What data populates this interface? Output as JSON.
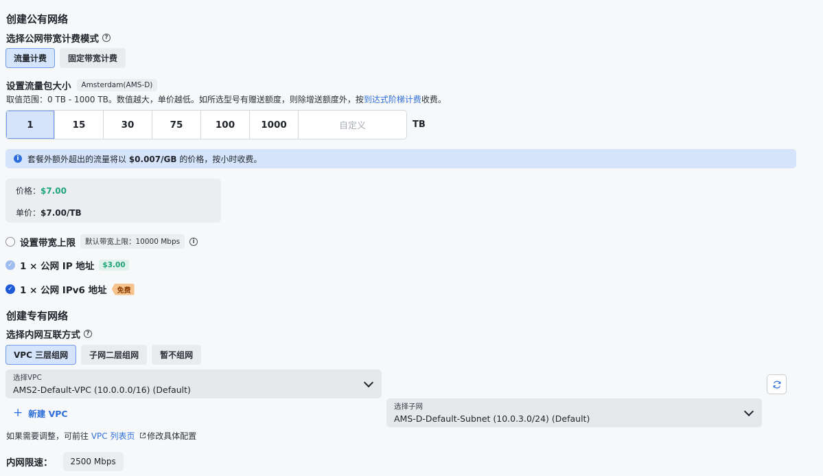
{
  "public_network": {
    "title": "创建公有网络",
    "billing_mode_title": "选择公网带宽计费模式",
    "billing_modes": [
      "流量计费",
      "固定带宽计费"
    ],
    "billing_mode_selected": "流量计费",
    "traffic_title": "设置流量包大小",
    "region_tag": "Amsterdam(AMS-D)",
    "range_text_prefix": "取值范围：0 TB - 1000 TB。数值越大，单价越低。如所选型号有赠送额度，则除增送额度外，按",
    "range_link": "到达式阶梯计费",
    "range_text_suffix": "收费。",
    "sizes": [
      "1",
      "15",
      "30",
      "75",
      "100",
      "1000"
    ],
    "size_selected": "1",
    "custom_placeholder": "自定义",
    "unit": "TB",
    "notice_prefix": "套餐外额外超出的流量将以 ",
    "notice_price": "$0.007/GB",
    "notice_suffix": " 的价格，按小时收费。",
    "price_label": "价格：",
    "price_value": "$7.00",
    "unit_price_label": "单价：",
    "unit_price_value": "$7.00/TB",
    "bandwidth_limit_label": "设置带宽上限",
    "bandwidth_limit_tag": "默认带宽上限：10000 Mbps",
    "ipv4_label": "1 × 公网 IP 地址",
    "ipv4_price": "$3.00",
    "ipv6_label": "1 × 公网 IPv6 地址",
    "ipv6_badge": "免费"
  },
  "private_network": {
    "title": "创建专有网络",
    "mode_title": "选择内网互联方式",
    "modes": [
      "VPC 三层组网",
      "子网二层组网",
      "暂不组网"
    ],
    "mode_selected": "VPC 三层组网",
    "vpc_select_label": "选择VPC",
    "vpc_select_value": "AMS2-Default-VPC (10.0.0.0/16) (Default)",
    "subnet_select_label": "选择子网",
    "subnet_select_value": "AMS-D-Default-Subnet (10.0.3.0/24) (Default)",
    "new_vpc_label": "新建 VPC",
    "adjust_prefix": "如果需要调整，可前往 ",
    "adjust_link": "VPC 列表页",
    "adjust_suffix": "修改具体配置",
    "speed_label": "内网限速：",
    "speed_value": "2500 Mbps"
  },
  "colors": {
    "accent": "#2f6fdb",
    "selected_bg": "#d6e4fb",
    "price_green": "#1fa67a",
    "free_badge": "#f6c38f"
  },
  "icons": [
    "help-circle-icon",
    "info-icon",
    "external-link-icon",
    "chevron-down-icon",
    "refresh-icon",
    "plus-icon",
    "check-icon"
  ]
}
